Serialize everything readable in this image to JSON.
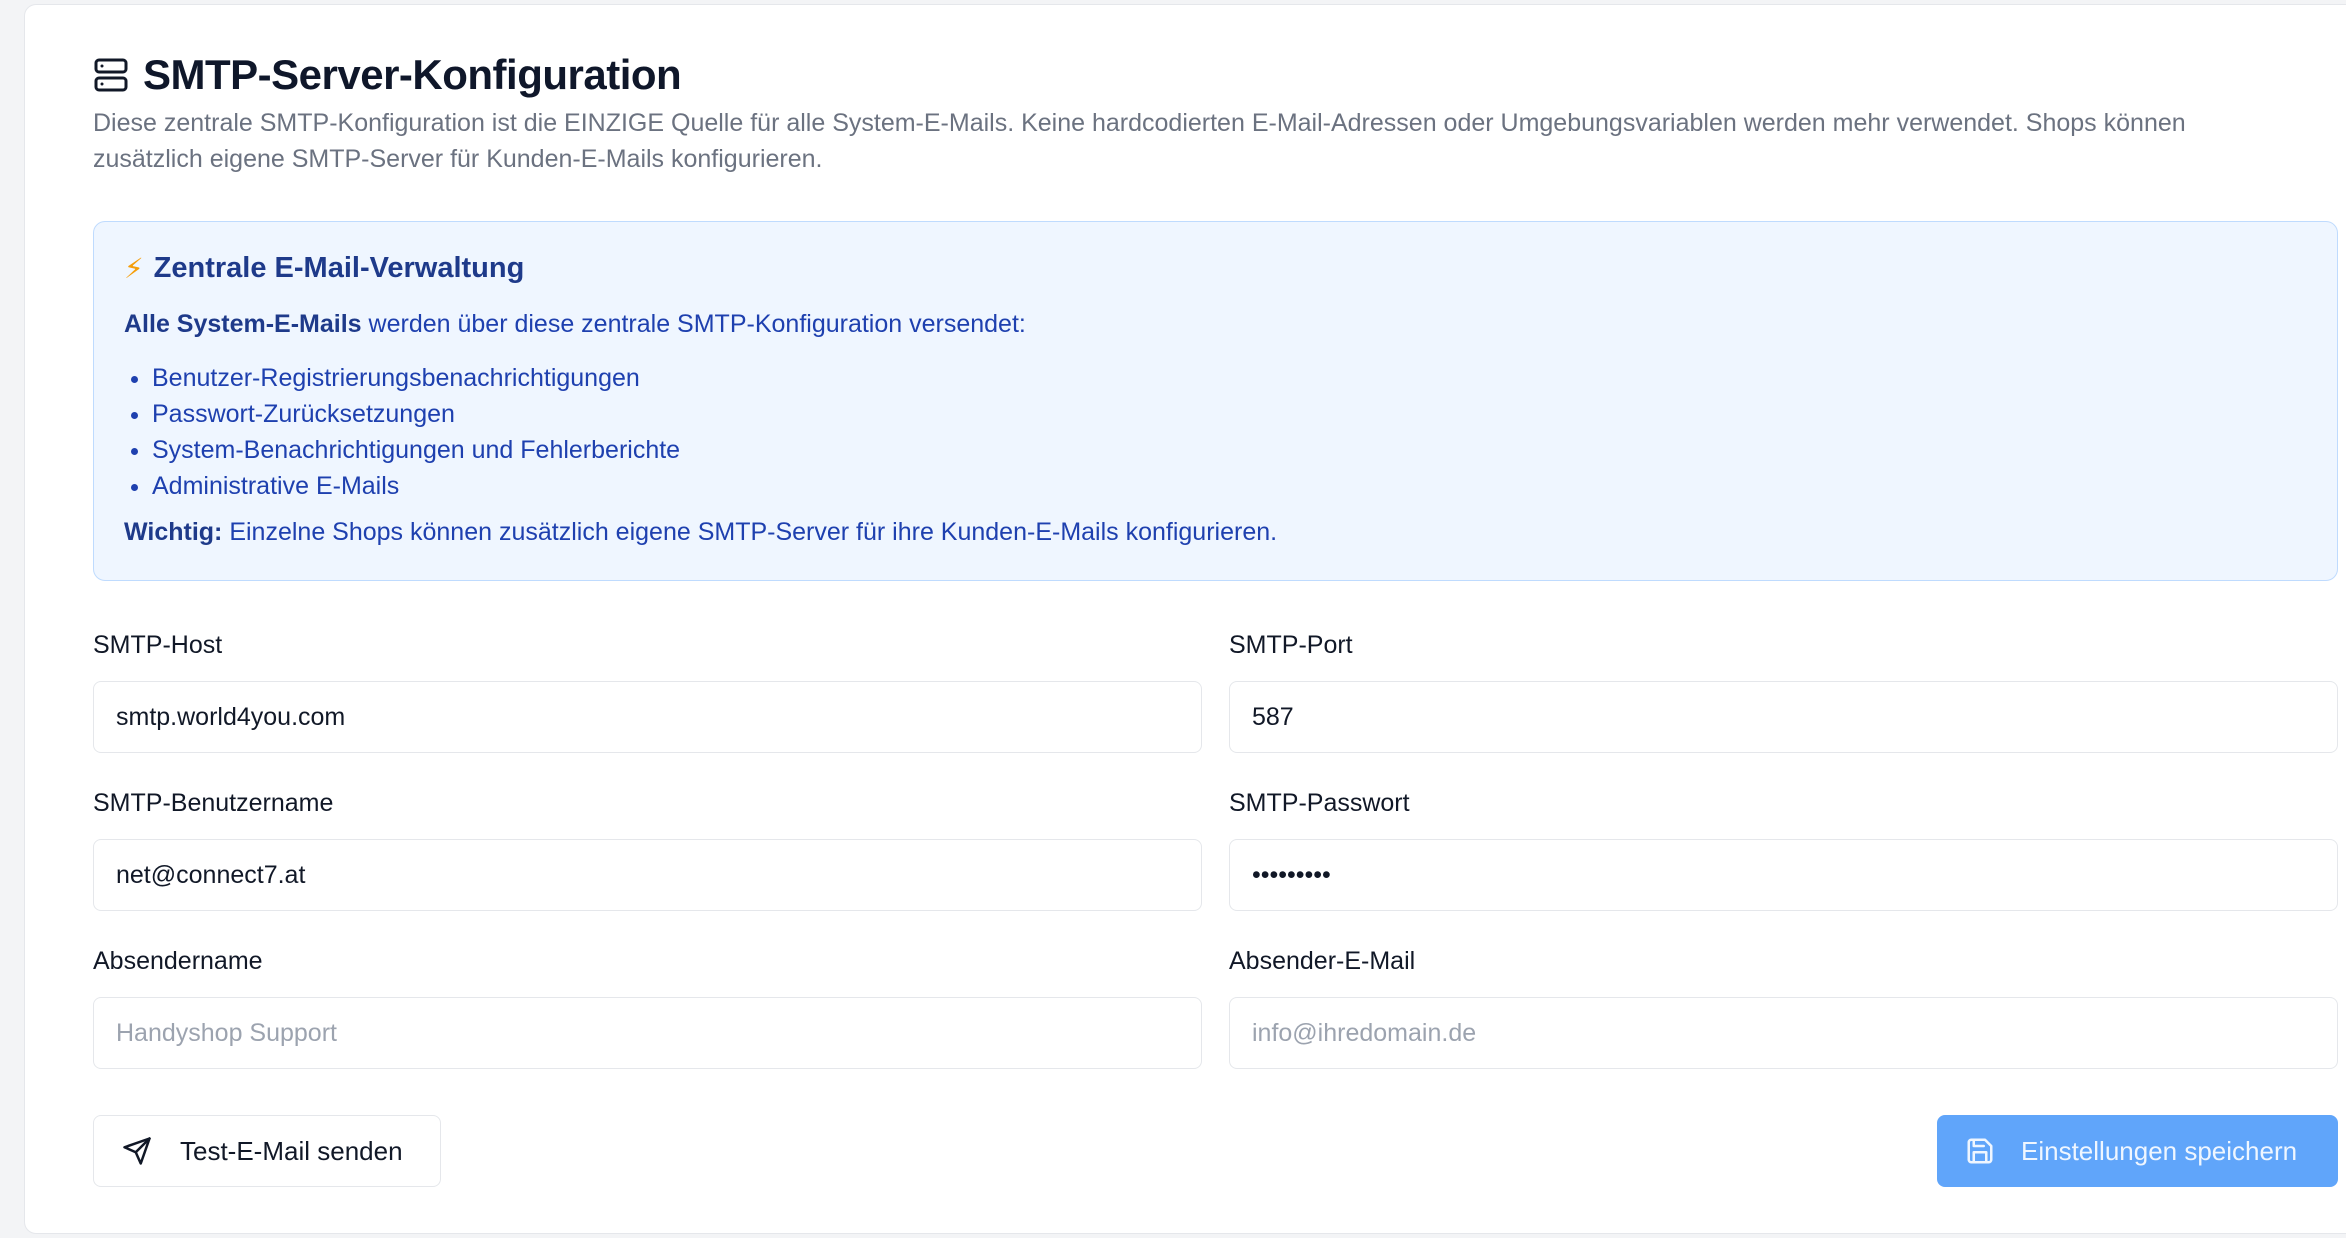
{
  "header": {
    "icon": "server-icon",
    "title": "SMTP-Server-Konfiguration",
    "description": "Diese zentrale SMTP-Konfiguration ist die EINZIGE Quelle für alle System-E-Mails. Keine hardcodierten E-Mail-Adressen oder Umgebungsvariablen werden mehr verwendet. Shops können zusätzlich eigene SMTP-Server für Kunden-E-Mails konfigurieren."
  },
  "info": {
    "icon": "lightning-icon",
    "icon_glyph": "⚡",
    "title": "Zentrale E-Mail-Verwaltung",
    "intro_strong": "Alle System-E-Mails",
    "intro_rest": " werden über diese zentrale SMTP-Konfiguration versendet:",
    "items": [
      "Benutzer-Registrierungsbenachrichtigungen",
      "Passwort-Zurücksetzungen",
      "System-Benachrichtigungen und Fehlerberichte",
      "Administrative E-Mails"
    ],
    "note_strong": "Wichtig:",
    "note_rest": " Einzelne Shops können zusätzlich eigene SMTP-Server für ihre Kunden-E-Mails konfigurieren."
  },
  "form": {
    "host": {
      "label": "SMTP-Host",
      "value": "smtp.world4you.com",
      "placeholder": ""
    },
    "port": {
      "label": "SMTP-Port",
      "value": "587",
      "placeholder": ""
    },
    "username": {
      "label": "SMTP-Benutzername",
      "value": "net@connect7.at",
      "placeholder": ""
    },
    "password": {
      "label": "SMTP-Passwort",
      "value": "•••••••••",
      "placeholder": ""
    },
    "sender_name": {
      "label": "Absendername",
      "value": "",
      "placeholder": "Handyshop Support"
    },
    "sender_email": {
      "label": "Absender-E-Mail",
      "value": "",
      "placeholder": "info@ihredomain.de"
    }
  },
  "actions": {
    "test_label": "Test-E-Mail senden",
    "test_icon": "send-icon",
    "save_label": "Einstellungen speichern",
    "save_icon": "save-icon"
  },
  "colors": {
    "accent": "#60a5fa",
    "info_bg": "#eff6ff",
    "info_text": "#1e40af"
  }
}
